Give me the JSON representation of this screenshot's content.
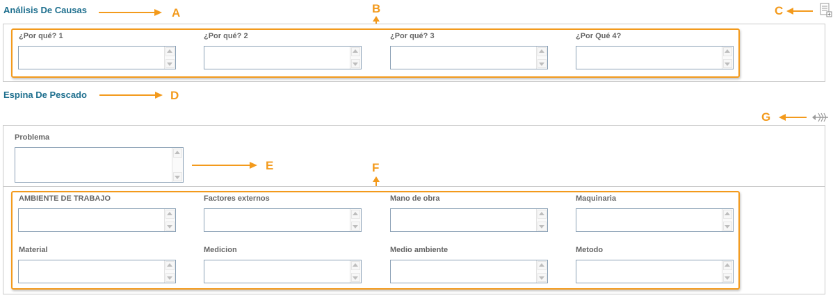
{
  "causes": {
    "title": "Análisis De Causas",
    "fields": [
      {
        "label": "¿Por qué? 1",
        "value": ""
      },
      {
        "label": "¿Por qué? 2",
        "value": ""
      },
      {
        "label": "¿Por qué? 3",
        "value": ""
      },
      {
        "label": "¿Por Qué 4?",
        "value": ""
      }
    ]
  },
  "fishbone": {
    "title": "Espina De Pescado",
    "problem": {
      "label": "Problema",
      "value": ""
    },
    "categories": [
      {
        "label": "AMBIENTE DE TRABAJO",
        "value": ""
      },
      {
        "label": "Factores externos",
        "value": ""
      },
      {
        "label": "Mano de obra",
        "value": ""
      },
      {
        "label": "Maquinaria",
        "value": ""
      },
      {
        "label": "Material",
        "value": ""
      },
      {
        "label": "Medicion",
        "value": ""
      },
      {
        "label": "Medio ambiente",
        "value": ""
      },
      {
        "label": "Metodo",
        "value": ""
      }
    ]
  },
  "annotations": {
    "A": "A",
    "B": "B",
    "C": "C",
    "D": "D",
    "E": "E",
    "F": "F",
    "G": "G"
  },
  "icons": {
    "add_doc": "add-document-icon",
    "fishbone": "fishbone-icon"
  },
  "colors": {
    "annotation": "#f39a1c",
    "title": "#1e6f8e",
    "label": "#666666",
    "border": "#c9c9c9"
  }
}
